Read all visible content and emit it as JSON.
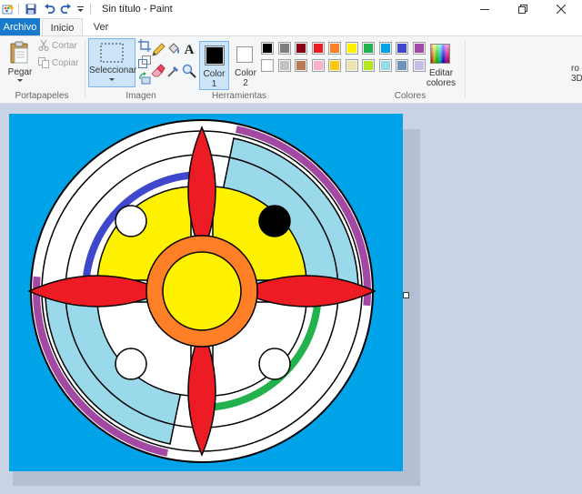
{
  "titlebar": {
    "title": "Sin título - Paint",
    "icons": [
      "paint-app-icon",
      "save-icon",
      "undo-icon",
      "redo-icon",
      "customize-arrow-icon"
    ],
    "controls": [
      "minimize-icon",
      "restore-icon",
      "close-icon"
    ]
  },
  "tabs": {
    "file": "Archivo",
    "home": "Inicio",
    "view": "Ver"
  },
  "ribbon": {
    "clipboard": {
      "paste": "Pegar",
      "cut": "Cortar",
      "copy": "Copiar",
      "group": "Portapapeles"
    },
    "image": {
      "select": "Seleccionar",
      "group": "Imagen"
    },
    "tools": {
      "group": "Herramientas",
      "text_tool": "A"
    },
    "colors": {
      "color1_label": "Color",
      "color1_num": "1",
      "color2_label": "Color",
      "color2_num": "2",
      "edit_line1": "Editar",
      "edit_line2": "colores",
      "group": "Colores",
      "right_cut_1": "ro",
      "right_cut_2": "3D",
      "color1": "#000000",
      "color2": "#ffffff",
      "palette_row1": [
        "#000000",
        "#7f7f7f",
        "#880015",
        "#ed1c24",
        "#ff7f27",
        "#fff200",
        "#22b14c",
        "#00a2e8",
        "#3f48cc",
        "#a349a4"
      ],
      "palette_row2": [
        "#ffffff",
        "#c3c3c3",
        "#b97a57",
        "#ffaec9",
        "#ffc90e",
        "#efe4b0",
        "#b5e61d",
        "#99d9ea",
        "#7092be",
        "#c8bfe7"
      ]
    }
  },
  "drawing": {
    "background": "#00a2e8",
    "colors": {
      "purple": "#a349a4",
      "blue": "#3f48cc",
      "green": "#22b14c",
      "yellow": "#fff200",
      "red": "#ed1c24",
      "orange": "#ff7f27",
      "light_blue": "#99d9ea",
      "white": "#ffffff",
      "black": "#000000"
    }
  }
}
